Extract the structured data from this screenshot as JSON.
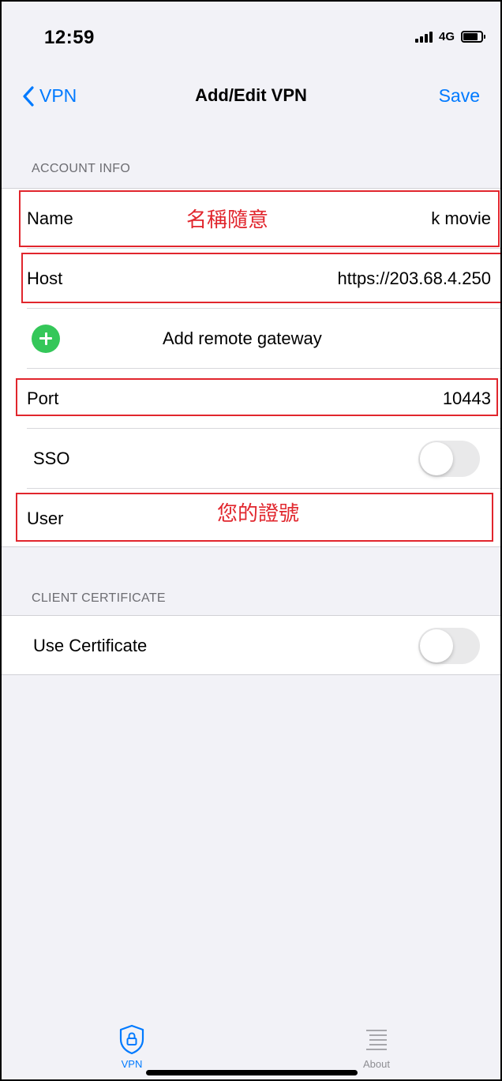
{
  "status_bar": {
    "time": "12:59",
    "network": "4G",
    "battery_level": 0.8
  },
  "nav": {
    "back_label": "VPN",
    "title": "Add/Edit VPN",
    "save_label": "Save"
  },
  "account_info": {
    "header": "ACCOUNT INFO",
    "name_label": "Name",
    "name_value": "k movie",
    "host_label": "Host",
    "host_value": "https://203.68.4.250",
    "add_gateway_label": "Add remote gateway",
    "port_label": "Port",
    "port_value": "10443",
    "sso_label": "SSO",
    "sso_enabled": false,
    "user_label": "User",
    "user_value": ""
  },
  "client_certificate": {
    "header": "CLIENT CERTIFICATE",
    "use_certificate_label": "Use Certificate",
    "use_certificate_enabled": false
  },
  "annotations": {
    "name_note": "名稱隨意",
    "user_note": "您的證號",
    "color": "#e1262d"
  },
  "tabbar": {
    "vpn_label": "VPN",
    "about_label": "About",
    "active": "VPN"
  },
  "colors": {
    "accent": "#007aff",
    "add_icon": "#34c759",
    "background": "#f2f2f7"
  }
}
